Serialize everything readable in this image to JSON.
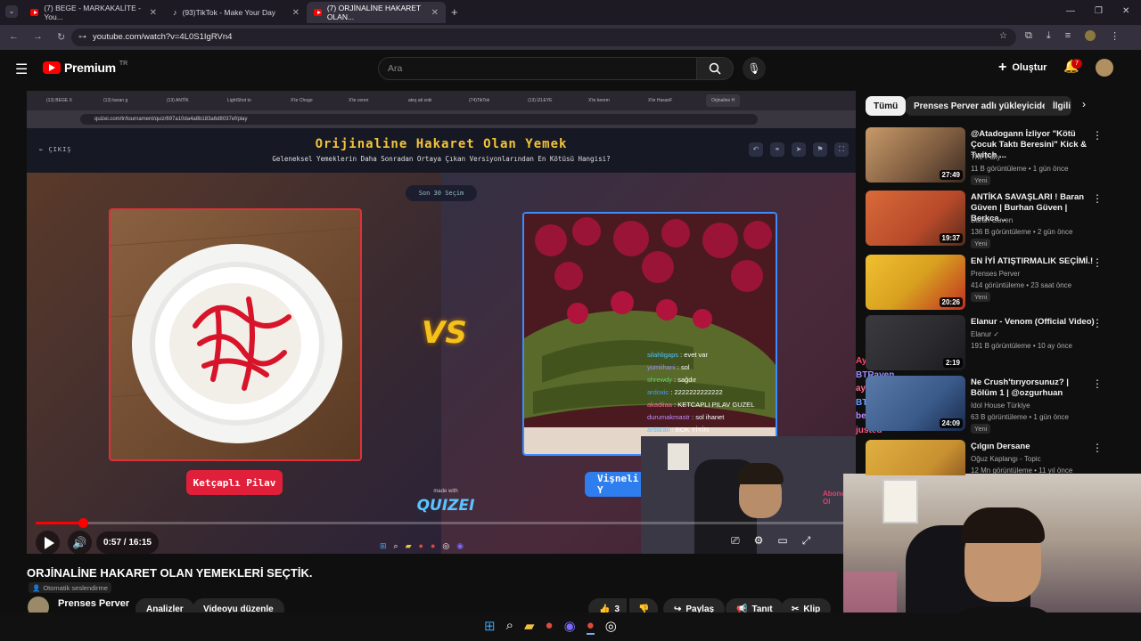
{
  "browser": {
    "tabs": [
      {
        "label": "(7) BEGE - MARKAKALİTE - You...",
        "active": false
      },
      {
        "label": "(93)TikTok - Make Your Day",
        "active": false
      },
      {
        "label": "(7) ORJİNALİNE HAKARET OLAN...",
        "active": true
      }
    ],
    "url": "youtube.com/watch?v=4L0S1IgRVn4"
  },
  "youtube": {
    "logo_text": "Premium",
    "logo_sup": "TR",
    "search_placeholder": "Ara",
    "create_label": "Oluştur",
    "notif_count": "7"
  },
  "video": {
    "inner_tabs": [
      "(13) BEGE X",
      "(13) baran g",
      "(13) ANTİK",
      "LightShot to",
      "X'te Chogo",
      "X'te ceren",
      "ateş ati zoki",
      "(74)TikTok",
      "(13) İZLEYE",
      "X'te kerem",
      "X'te HasanF",
      "Orjinaline H"
    ],
    "inner_url": "quizei.com/tr/tournament/quiz/697a10da4a8b183a6d8037ef/play",
    "exit_label": "ÇIKIŞ",
    "quiz_title": "Orijinaline Hakaret Olan Yemek",
    "quiz_subtitle": "Geleneksel Yemeklerin Daha Sonradan Ortaya Çıkan Versiyonlarından En Kötüsü Hangisi?",
    "round_label": "Son 30 Seçim",
    "left_choice": "Ketçaplı Pilav",
    "right_choice": "Vişneli Y",
    "made_with": "made with",
    "brand": "QUIZEI",
    "chat": [
      {
        "user": "silahligaps",
        "msg": "evet var",
        "color": "#4ec3ff"
      },
      {
        "user": "yumiihani",
        "msg": "sol",
        "color": "#9b8cff"
      },
      {
        "user": "shrewdy",
        "msg": "sağdır",
        "color": "#5ad06a"
      },
      {
        "user": "ardoxic",
        "msg": "2222222222222",
        "color": "#3ea0ff"
      },
      {
        "user": "akadiiaa",
        "msg": "KETCAPLI PILAV GUZEL",
        "color": "#ff6fa0"
      },
      {
        "user": "durumakmastr",
        "msg": "sol ihanet",
        "color": "#c08cff"
      },
      {
        "user": "ardaralı",
        "msg": "BOK YİYİN",
        "color": "#4ec3ff"
      }
    ],
    "time_current": "0:57",
    "time_total": "16:15",
    "progress": 0.058,
    "overlay_chat": [
      "AyGhost",
      "BTRaven",
      "ayceekinci",
      "BTRaven",
      "beyzeli",
      "justed"
    ],
    "webcam_sign": "Abone Ol"
  },
  "sidebar": {
    "chips": [
      "Tümü",
      "Prenses Perver adlı yükleyiciden",
      "İlgili"
    ],
    "videos": [
      {
        "title": "@Atadogann İzliyor \"Kötü Çocuk Taktı Beresini\" Kick & Twitch ...",
        "channel": "The Pally",
        "meta": "11 B görüntüleme • 1 gün önce",
        "duration": "27:49",
        "new": "Yeni",
        "thumb_color": "#7d5b3f"
      },
      {
        "title": "ANTİKA SAVAŞLARI ! Baran Güven | Burhan Güven | Berkca...",
        "channel": "Baran Guven",
        "meta": "136 B görüntüleme • 2 gün önce",
        "duration": "19:37",
        "new": "Yeni",
        "thumb_color": "#b84a2a"
      },
      {
        "title": "EN İYİ ATIŞTIRMALIK SEÇİMİ.!",
        "channel": "Prenses Perver",
        "meta": "414 görüntüleme • 23 saat önce",
        "duration": "20:26",
        "new": "Yeni",
        "thumb_color": "#d8a020"
      },
      {
        "title": "Elanur - Venom (Official Video)",
        "channel": "Elanur",
        "meta": "191 B görüntüleme • 10 ay önce",
        "duration": "2:19",
        "new": "",
        "thumb_color": "#2a2a2e"
      },
      {
        "title": "Ne Crush'tırıyorsunuz? | Bölüm 1 | @ozgurhuan",
        "channel": "Idol House Türkiye",
        "meta": "63 B görüntüleme • 1 gün önce",
        "duration": "24:09",
        "new": "Yeni",
        "thumb_color": "#3a5a8a"
      },
      {
        "title": "Çılgın Dersane",
        "channel": "Oğuz Kaplangı - Topic",
        "meta": "12 Mn görüntüleme • 11 yıl önce",
        "duration": "",
        "new": "",
        "thumb_color": "#c89030"
      }
    ]
  },
  "below": {
    "title": "ORJİNALİNE HAKARET OLAN YEMEKLERİ SEÇTİK.",
    "dub": "Otomatik seslendirme",
    "channel": "Prenses Perver",
    "analytics": "Analizler",
    "edit": "Videoyu düzenle",
    "likes": "3",
    "share": "Paylaş",
    "promote": "Tanıt",
    "clip": "Klip"
  }
}
